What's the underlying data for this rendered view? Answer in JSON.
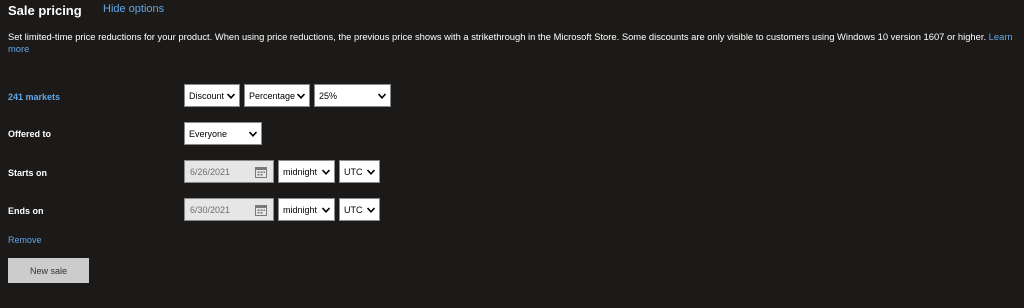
{
  "header": {
    "title": "Sale pricing",
    "hide_options": "Hide options"
  },
  "description": {
    "text": "Set limited-time price reductions for your product. When using price reductions, the previous price shows with a strikethrough in the Microsoft Store. Some discounts are only visible to customers using Windows 10 version 1607 or higher.",
    "learn_more": "Learn more"
  },
  "markets": {
    "label": "241 markets",
    "type": "Discount",
    "unit": "Percentage",
    "amount": "25%"
  },
  "offered_to": {
    "label": "Offered to",
    "value": "Everyone"
  },
  "starts_on": {
    "label": "Starts on",
    "date": "6/26/2021",
    "time": "midnight",
    "timezone": "UTC"
  },
  "ends_on": {
    "label": "Ends on",
    "date": "6/30/2021",
    "time": "midnight",
    "timezone": "UTC"
  },
  "actions": {
    "remove": "Remove",
    "new_sale": "New sale"
  },
  "colors": {
    "background": "#1b1a19",
    "link": "#62a6e6",
    "button": "#cccccc"
  }
}
